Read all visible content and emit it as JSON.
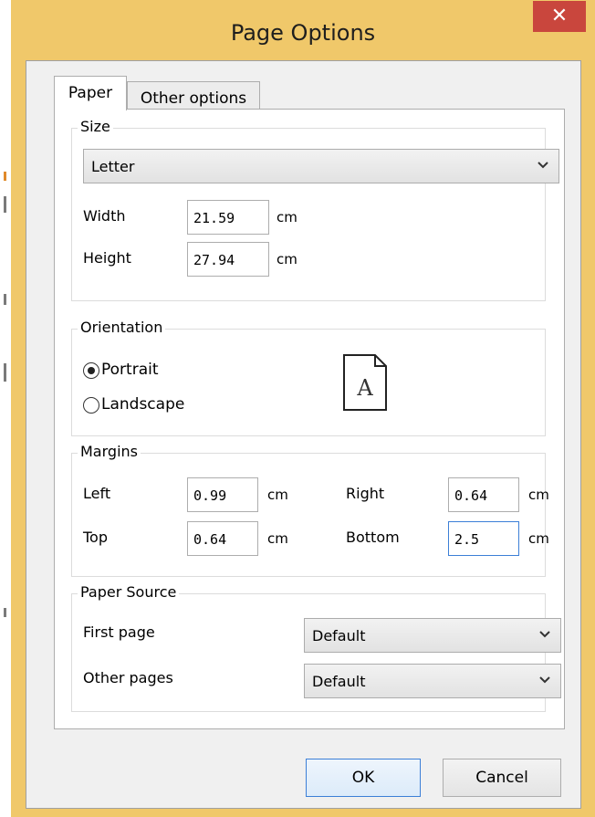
{
  "window": {
    "title": "Page Options",
    "close_glyph": "✕"
  },
  "tabs": [
    {
      "label": "Paper",
      "selected": true
    },
    {
      "label": "Other options",
      "selected": false
    }
  ],
  "size": {
    "legend": "Size",
    "paper_selected": "Letter",
    "width_label": "Width",
    "width_value": "21.59",
    "height_label": "Height",
    "height_value": "27.94",
    "unit": "cm"
  },
  "orientation": {
    "legend": "Orientation",
    "portrait_label": "Portrait",
    "landscape_label": "Landscape",
    "selected": "portrait",
    "preview_letter": "A"
  },
  "margins": {
    "legend": "Margins",
    "left_label": "Left",
    "left_value": "0.99",
    "right_label": "Right",
    "right_value": "0.64",
    "top_label": "Top",
    "top_value": "0.64",
    "bottom_label": "Bottom",
    "bottom_value": "2.5",
    "unit": "cm"
  },
  "paper_source": {
    "legend": "Paper Source",
    "first_page_label": "First page",
    "first_page_value": "Default",
    "other_pages_label": "Other pages",
    "other_pages_value": "Default"
  },
  "buttons": {
    "ok": "OK",
    "cancel": "Cancel"
  },
  "colors": {
    "title_bar": "#f0c86a",
    "close_button": "#c9463d",
    "focus_border": "#3c7fd7"
  },
  "icons": {
    "close": "close-icon",
    "dropdown": "chevron-down-icon",
    "orientation_preview": "page-portrait-icon"
  }
}
